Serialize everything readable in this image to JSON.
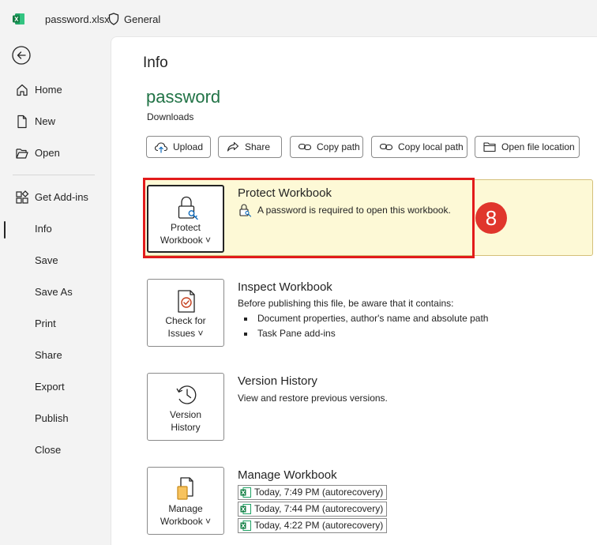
{
  "titlebar": {
    "file_name": "password.xlsx",
    "sensitivity_label": "General"
  },
  "sidebar": {
    "items": [
      {
        "label": "Home"
      },
      {
        "label": "New"
      },
      {
        "label": "Open"
      },
      {
        "label": "Get Add-ins"
      },
      {
        "label": "Info"
      },
      {
        "label": "Save"
      },
      {
        "label": "Save As"
      },
      {
        "label": "Print"
      },
      {
        "label": "Share"
      },
      {
        "label": "Export"
      },
      {
        "label": "Publish"
      },
      {
        "label": "Close"
      }
    ]
  },
  "main": {
    "page_title": "Info",
    "doc_name": "password",
    "doc_location": "Downloads",
    "actions": {
      "upload": "Upload",
      "share": "Share",
      "copy_path": "Copy path",
      "copy_local_path": "Copy local path",
      "open_file_location": "Open file location"
    },
    "protect": {
      "button_line1": "Protect",
      "button_line2": "Workbook ˅",
      "title": "Protect Workbook",
      "status": "A password is required to open this workbook."
    },
    "step_badge": "8",
    "inspect": {
      "button_line1": "Check for",
      "button_line2": "Issues ˅",
      "title": "Inspect Workbook",
      "description": "Before publishing this file, be aware that it contains:",
      "bullets": [
        "Document properties, author's name and absolute path",
        "Task Pane add-ins"
      ]
    },
    "history": {
      "button_line1": "Version",
      "button_line2": "History",
      "title": "Version History",
      "description": "View and restore previous versions."
    },
    "manage": {
      "button_line1": "Manage",
      "button_line2": "Workbook ˅",
      "title": "Manage Workbook",
      "versions": [
        "Today, 7:49 PM (autorecovery)",
        "Today, 7:44 PM (autorecovery)",
        "Today, 4:22 PM (autorecovery)"
      ]
    }
  },
  "colors": {
    "accent_green": "#217346",
    "highlight_red": "#e21b1b",
    "protect_bg": "#fdf9d6",
    "badge_red": "#e0362c"
  }
}
